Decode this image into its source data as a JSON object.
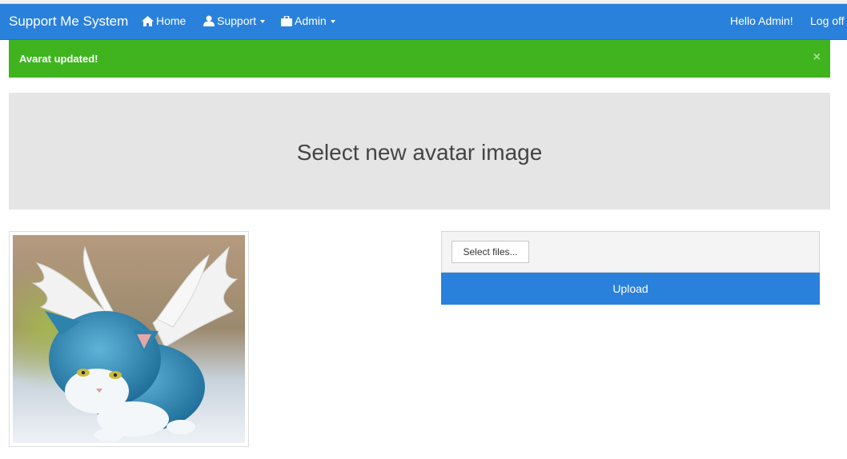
{
  "navbar": {
    "brand": "Support Me System",
    "items": [
      {
        "label": "Home",
        "icon": "home-icon"
      },
      {
        "label": "Support",
        "icon": "user-icon",
        "dropdown": true
      },
      {
        "label": "Admin",
        "icon": "briefcase-icon",
        "dropdown": true
      }
    ],
    "greeting": "Hello Admin!",
    "logoff": "Log off"
  },
  "alert": {
    "message": "Avarat updated!",
    "close": "×",
    "color": "#3fb41f"
  },
  "jumbotron": {
    "title": "Select new avatar image"
  },
  "avatar": {
    "alt": "avatar image of a blue kitten with wings"
  },
  "upload": {
    "select_label": "Select files...",
    "upload_label": "Upload"
  },
  "colors": {
    "primary": "#2a81dc",
    "success": "#3fb41f",
    "jumbotron_bg": "#e5e5e5"
  }
}
